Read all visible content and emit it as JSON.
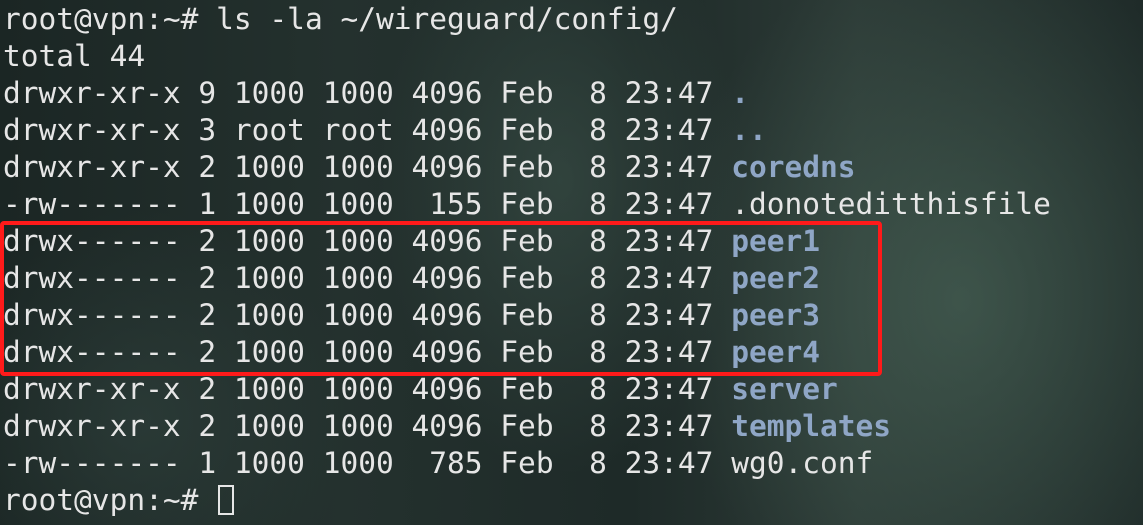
{
  "command_line": {
    "prompt": "root@vpn:~#",
    "command": "ls -la ~/wireguard/config/"
  },
  "total_line": "total 44",
  "entries": [
    {
      "meta": "drwxr-xr-x 9 1000 1000 4096 Feb  8 23:47",
      "name": ".",
      "kind": "dir"
    },
    {
      "meta": "drwxr-xr-x 3 root root 4096 Feb  8 23:47",
      "name": "..",
      "kind": "dir"
    },
    {
      "meta": "drwxr-xr-x 2 1000 1000 4096 Feb  8 23:47",
      "name": "coredns",
      "kind": "dir"
    },
    {
      "meta": "-rw------- 1 1000 1000  155 Feb  8 23:47",
      "name": ".donoteditthisfile",
      "kind": "file"
    },
    {
      "meta": "drwx------ 2 1000 1000 4096 Feb  8 23:47",
      "name": "peer1",
      "kind": "dir"
    },
    {
      "meta": "drwx------ 2 1000 1000 4096 Feb  8 23:47",
      "name": "peer2",
      "kind": "dir"
    },
    {
      "meta": "drwx------ 2 1000 1000 4096 Feb  8 23:47",
      "name": "peer3",
      "kind": "dir"
    },
    {
      "meta": "drwx------ 2 1000 1000 4096 Feb  8 23:47",
      "name": "peer4",
      "kind": "dir"
    },
    {
      "meta": "drwxr-xr-x 2 1000 1000 4096 Feb  8 23:47",
      "name": "server",
      "kind": "dir"
    },
    {
      "meta": "drwxr-xr-x 2 1000 1000 4096 Feb  8 23:47",
      "name": "templates",
      "kind": "dir"
    },
    {
      "meta": "-rw------- 1 1000 1000  785 Feb  8 23:47",
      "name": "wg0.conf",
      "kind": "file"
    }
  ],
  "final_prompt": "root@vpn:~#",
  "colors": {
    "text": "#e6e6e6",
    "directory": "#8fa6c6",
    "highlight": "#ff1a1a"
  }
}
